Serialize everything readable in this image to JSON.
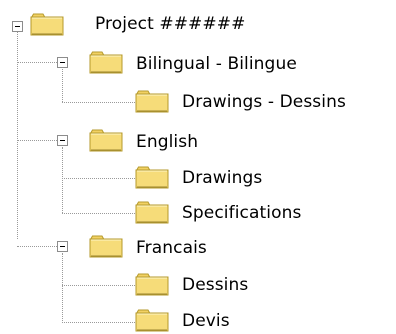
{
  "tree": {
    "root": {
      "label": "Project ######",
      "icon": "folder-icon"
    },
    "groups": [
      {
        "label": "Bilingual - Bilingue",
        "icon": "folder-icon",
        "children": [
          {
            "label": "Drawings - Dessins",
            "icon": "folder-icon"
          }
        ]
      },
      {
        "label": "English",
        "icon": "folder-icon",
        "children": [
          {
            "label": "Drawings",
            "icon": "folder-icon"
          },
          {
            "label": "Specifications",
            "icon": "folder-icon"
          }
        ]
      },
      {
        "label": "Francais",
        "icon": "folder-icon",
        "children": [
          {
            "label": "Dessins",
            "icon": "folder-icon"
          },
          {
            "label": "Devis",
            "icon": "folder-icon"
          }
        ]
      }
    ]
  },
  "colors": {
    "folder_fill": "#f6dc79",
    "folder_outline": "#b59a2c",
    "connector": "#9a9a9a",
    "toggle_border": "#8c8c8c"
  }
}
